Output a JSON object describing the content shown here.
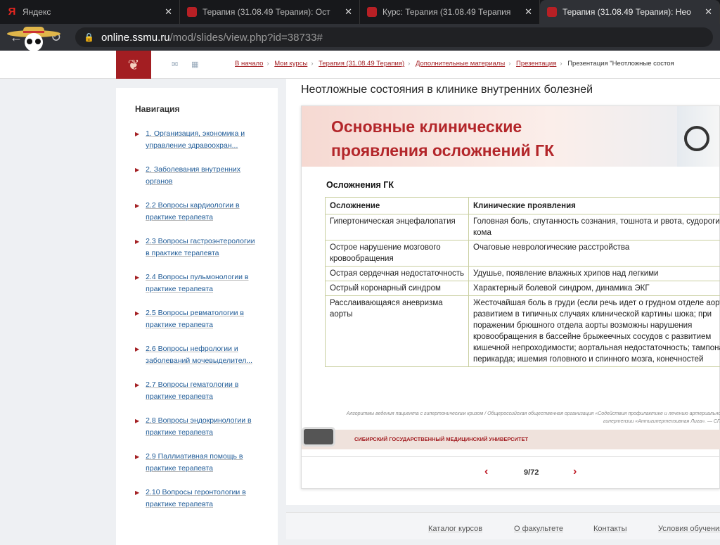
{
  "browser": {
    "tabs": [
      {
        "title": "Яндекс",
        "icon": "yandex-icon"
      },
      {
        "title": "Терапия (31.08.49 Терапия): Ост",
        "icon": "ssmu-icon"
      },
      {
        "title": "Курс: Терапия (31.08.49 Терапия",
        "icon": "ssmu-icon"
      },
      {
        "title": "Терапия (31.08.49 Терапия): Нео",
        "icon": "ssmu-icon",
        "active": true
      }
    ],
    "url_host": "online.ssmu.ru",
    "url_path": "/mod/slides/view.php?id=38733#"
  },
  "breadcrumb": [
    "В начало",
    "Мои курсы",
    "Терапия (31.08.49 Терапия)",
    "Дополнительные материалы",
    "Презентация",
    "Презентация \"Неотложные состоя"
  ],
  "navigation": {
    "title": "Навигация",
    "items": [
      "1. Организация, экономика и управление здравоохран...",
      "2. Заболевания внутренних органов",
      "2.2 Вопросы кардиологии в практике терапевта",
      "2.3 Вопросы гастроэнтерологии в практике терапевта",
      "2.4 Вопросы пульмонологии в практике терапевта",
      "2.5 Вопросы ревматологии в практике терапевта",
      "2.6 Вопросы нефрологии и заболеваний мочевыделител...",
      "2.7 Вопросы гематологии в практике терапевта",
      "2.8 Вопросы эндокринологии в практике терапевта",
      "2.9 Паллиативная помощь в практике терапевта",
      "2.10 Вопросы геронтологии в практике терапевта"
    ]
  },
  "page_title": "Неотложные состояния в клинике внутренних болезней",
  "slide": {
    "heading_1": "Основные клинические",
    "heading_2": "проявления осложнений ГК",
    "subtitle": "Осложнения ГК",
    "columns": [
      "Осложнение",
      "Клинические проявления"
    ],
    "rows": [
      [
        "Гипертоническая энцефалопатия",
        "Головная боль, спутанность сознания, тошнота и рвота, судороги, кома"
      ],
      [
        "Острое нарушение мозгового кровообращения",
        "Очаговые неврологические расстройства"
      ],
      [
        "Острая сердечная недостаточность",
        "Удушье, появление влажных хрипов над легкими"
      ],
      [
        "Острый коронарный синдром",
        "Характерный болевой синдром, динамика ЭКГ"
      ],
      [
        "Расслаивающаяся аневризма аорты",
        "Жесточайшая боль в груди (если речь идет о грудном отделе аорты) с развитием в типичных случаях клинической картины шока; при поражении брюшного отдела аорты возможны нарушения кровообращения в бассейне брыжеечных сосудов с развитием кишечной непроходимости; аортальная недостаточность; тампонада перикарда; ишемия головного и спинного мозга, конечностей"
      ]
    ],
    "citation": "Алгоритмы ведения пациента с гипертоническим кризом / Общероссийская общественная организация «Содействия профилактике и лечению артериальной гипертензии «Антигипертензивная Лига». — СПб",
    "footer_band": "СИБИРСКИЙ ГОСУДАРСТВЕННЫЙ МЕДИЦИНСКИЙ УНИВЕРСИТЕТ"
  },
  "pager": {
    "current": "9/72",
    "prev": "‹",
    "next": "›"
  },
  "footer_links": [
    "Каталог курсов",
    "О факультете",
    "Контакты",
    "Условия обучения"
  ]
}
